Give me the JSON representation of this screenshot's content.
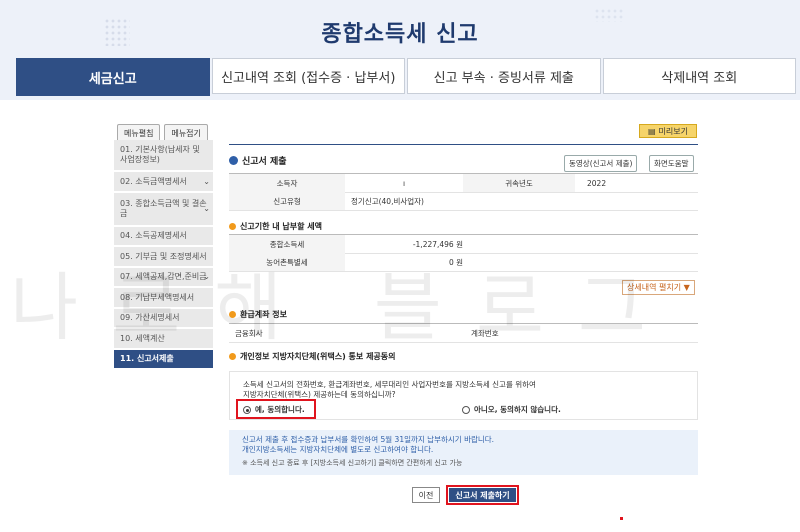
{
  "page": {
    "title": "종합소득세 신고",
    "watermark": "나로해 블로그"
  },
  "tabs": [
    {
      "label": "세금신고",
      "active": true
    },
    {
      "label": "신고내역 조회 (접수증 · 납부서)",
      "active": false
    },
    {
      "label": "신고 부속 · 증빙서류 제출",
      "active": false
    },
    {
      "label": "삭제내역 조회",
      "active": false
    }
  ],
  "sidebar": {
    "expand_label": "메뉴펼침",
    "collapse_label": "메뉴접기",
    "items": [
      {
        "label": "01. 기본사항(납세자 및 사업장정보)"
      },
      {
        "label": "02. 소득금액명세서"
      },
      {
        "label": "03. 종합소득금액 및 결손금"
      },
      {
        "label": "04. 소득공제명세서"
      },
      {
        "label": "05. 기부금 및 조정명세서"
      },
      {
        "label": "07. 세액공제,감면,준비금"
      },
      {
        "label": "08. 기납부세액명세서"
      },
      {
        "label": "09. 가산세명세서"
      },
      {
        "label": "10. 세액계산"
      },
      {
        "label": "11. 신고서제출"
      }
    ]
  },
  "main": {
    "preview_label": "미리보기",
    "section_title": "신고서 제출",
    "video_btn": "동영상(신고서 제출)",
    "help_btn": "화면도움말",
    "info": {
      "taxpayer_label": "소득자",
      "taxpayer_value": "ı",
      "year_label": "귀속년도",
      "year_value": "2022",
      "type_label": "신고유형",
      "type_value": "정기신고(40,비사업자)"
    },
    "payment": {
      "title": "신고기한 내 납부할 세액",
      "income_tax_label": "종합소득세",
      "income_tax_value": "-1,227,496 원",
      "farm_tax_label": "농어촌특별세",
      "farm_tax_value": "0 원"
    },
    "detail_link": "상세내역 펼치기 ▼",
    "refund": {
      "title": "환급계좌 정보",
      "bank_label": "금융회사",
      "account_label": "계좌번호"
    },
    "consent": {
      "title": "개인정보 지방자치단체(위택스) 통보 제공동의",
      "text1": "소득세 신고서의 전화번호, 환급계좌번호, 세무대리인 사업자번호를 지방소득세 신고를 위하여",
      "text2": "지방자치단체(위택스) 제공하는데 동의하십니까?",
      "yes": "예, 동의합니다.",
      "no": "아니오, 동의하지 않습니다."
    },
    "notice": {
      "line1": "신고서 제출 후 접수증과 납부서를 확인하여 5월 31일까지 납부하시기 바랍니다.",
      "line2": "개인지방소득세는 지방자치단체에 별도로 신고하여야 합니다.",
      "line3": "※ 소득세 신고 종료 후 [지방소득세 신고하기] 클릭하면 간편하게 신고 가능"
    },
    "prev_btn": "이전",
    "submit_btn": "신고서 제출하기"
  }
}
